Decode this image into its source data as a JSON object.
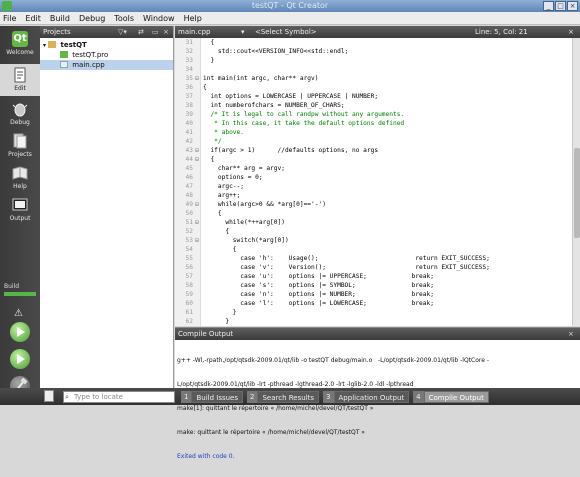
{
  "window": {
    "title": "testQT - Qt Creator"
  },
  "menu": [
    "File",
    "Edit",
    "Build",
    "Debug",
    "Tools",
    "Window",
    "Help"
  ],
  "modes": [
    {
      "label": "Welcome",
      "icon": "qt-logo-icon",
      "active": false
    },
    {
      "label": "Edit",
      "icon": "edit-icon",
      "active": true
    },
    {
      "label": "Debug",
      "icon": "debug-icon",
      "active": false
    },
    {
      "label": "Projects",
      "icon": "projects-icon",
      "active": false
    },
    {
      "label": "Help",
      "icon": "help-icon",
      "active": false
    },
    {
      "label": "Output",
      "icon": "output-icon",
      "active": false
    }
  ],
  "build": {
    "label": "Build"
  },
  "projects": {
    "header": "Projects",
    "tree": [
      {
        "label": "testQT",
        "level": 0,
        "selected": false
      },
      {
        "label": "testQT.pro",
        "level": 1,
        "selected": false
      },
      {
        "label": "main.cpp",
        "level": 1,
        "selected": true
      }
    ]
  },
  "editor": {
    "file": "main.cpp",
    "symbol": "<Select Symbol>",
    "position": "Line: 5, Col: 21",
    "lines": [
      {
        "n": "31",
        "t": "  {"
      },
      {
        "n": "32",
        "t": "    std::cout<<VERSION_INFO<<std::endl;"
      },
      {
        "n": "33",
        "t": "  }"
      },
      {
        "n": "34",
        "t": ""
      },
      {
        "n": "35",
        "t": "int main(int argc, char** argv)"
      },
      {
        "n": "36",
        "t": "{"
      },
      {
        "n": "37",
        "t": "  int options = LOWERCASE | UPPERCASE | NUMBER;"
      },
      {
        "n": "38",
        "t": "  int numberofchars = NUMBER_OF_CHARS;"
      },
      {
        "n": "39",
        "t": "  /* It is legal to call randpw without any arguments."
      },
      {
        "n": "40",
        "t": "   * In this case, it take the default options defined"
      },
      {
        "n": "41",
        "t": "   * above."
      },
      {
        "n": "42",
        "t": "   */"
      },
      {
        "n": "43",
        "t": "  if(argc > 1)      //defaults options, no args"
      },
      {
        "n": "44",
        "t": "  {"
      },
      {
        "n": "45",
        "t": "    char** arg = argv;"
      },
      {
        "n": "46",
        "t": "    options = 0;"
      },
      {
        "n": "47",
        "t": "    argc--;"
      },
      {
        "n": "48",
        "t": "    arg++;"
      },
      {
        "n": "49",
        "t": "    while(argc>0 && *arg[0]=='-')"
      },
      {
        "n": "50",
        "t": "    {"
      },
      {
        "n": "51",
        "t": "      while(*++arg[0])"
      },
      {
        "n": "52",
        "t": "      {"
      },
      {
        "n": "53",
        "t": "        switch(*arg[0])"
      },
      {
        "n": "54",
        "t": "        {"
      },
      {
        "n": "55",
        "t": "          case 'h':    Usage();                          return EXIT_SUCCESS;"
      },
      {
        "n": "56",
        "t": "          case 'v':    Version();                        return EXIT_SUCCESS;"
      },
      {
        "n": "57",
        "t": "          case 'u':    options |= UPPERCASE;            break;"
      },
      {
        "n": "58",
        "t": "          case 's':    options |= SYMBOL;               break;"
      },
      {
        "n": "59",
        "t": "          case 'n':    options |= NUMBER;               break;"
      },
      {
        "n": "60",
        "t": "          case 'l':    options |= LOWERCASE;            break;"
      },
      {
        "n": "61",
        "t": "        }"
      },
      {
        "n": "62",
        "t": "      }"
      }
    ]
  },
  "compile": {
    "header": "Compile Output",
    "lines": [
      "g++ -Wl,-rpath,/opt/qtsdk-2009.01/qt/lib -o testQT debug/main.o   -L/opt/qtsdk-2009.01/qt/lib -lQtCore -",
      "L/opt/qtsdk-2009.01/qt/lib -lrt -pthread -lgthread-2.0 -lrt -lglib-2.0 -ldl -lpthread",
      "make[1]: quittant le répertoire « /home/michel/devel/QT/testQT »",
      "make: quittant le répertoire « /home/michel/devel/QT/testQT »",
      "Exited with code 0."
    ]
  },
  "status": {
    "locate_placeholder": "Type to locate",
    "panes": [
      {
        "num": "1",
        "label": "Build Issues",
        "on": false
      },
      {
        "num": "2",
        "label": "Search Results",
        "on": false
      },
      {
        "num": "3",
        "label": "Application Output",
        "on": false
      },
      {
        "num": "4",
        "label": "Compile Output",
        "on": true
      }
    ]
  }
}
